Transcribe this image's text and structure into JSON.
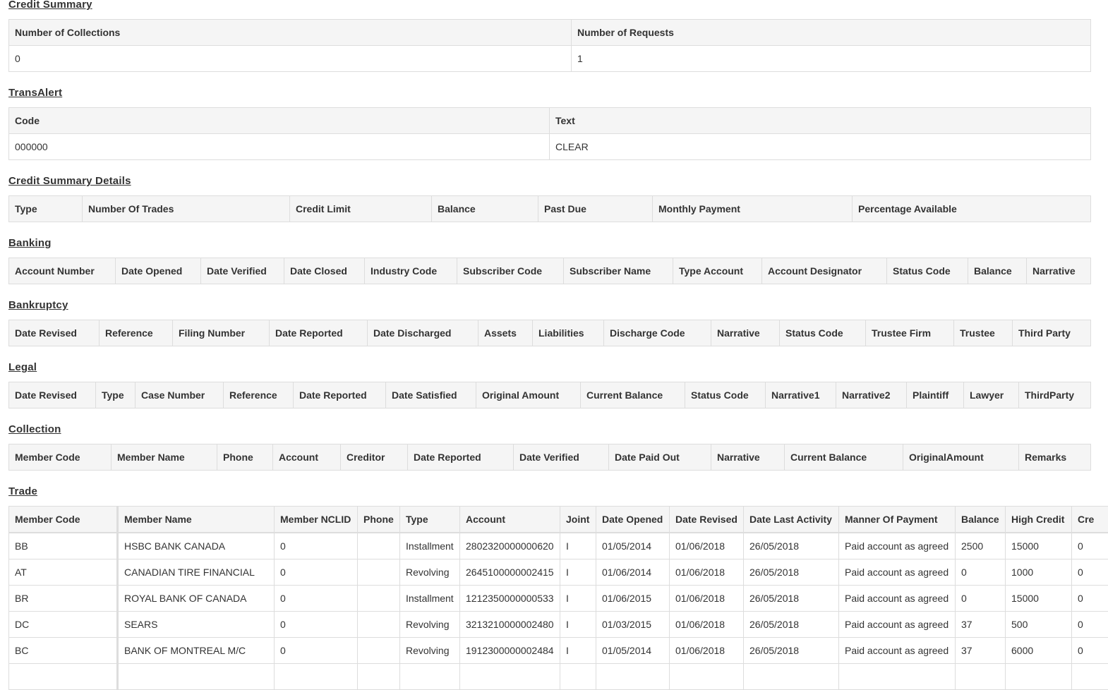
{
  "credit_summary": {
    "title": "Credit Summary",
    "headers": [
      "Number of Collections",
      "Number of Requests"
    ],
    "values": [
      "0",
      "1"
    ]
  },
  "transalert": {
    "title": "TransAlert",
    "headers": [
      "Code",
      "Text"
    ],
    "values": [
      "000000",
      "CLEAR"
    ]
  },
  "credit_summary_details": {
    "title": "Credit Summary Details",
    "headers": [
      "Type",
      "Number Of Trades",
      "Credit Limit",
      "Balance",
      "Past Due",
      "Monthly Payment",
      "Percentage Available"
    ]
  },
  "banking": {
    "title": "Banking",
    "headers": [
      "Account Number",
      "Date Opened",
      "Date Verified",
      "Date Closed",
      "Industry Code",
      "Subscriber Code",
      "Subscriber Name",
      "Type Account",
      "Account Designator",
      "Status Code",
      "Balance",
      "Narrative"
    ]
  },
  "bankruptcy": {
    "title": "Bankruptcy",
    "headers": [
      "Date Revised",
      "Reference",
      "Filing Number",
      "Date Reported",
      "Date Discharged",
      "Assets",
      "Liabilities",
      "Discharge Code",
      "Narrative",
      "Status Code",
      "Trustee Firm",
      "Trustee",
      "Third Party"
    ]
  },
  "legal": {
    "title": "Legal",
    "headers": [
      "Date Revised",
      "Type",
      "Case Number",
      "Reference",
      "Date Reported",
      "Date Satisfied",
      "Original Amount",
      "Current Balance",
      "Status Code",
      "Narrative1",
      "Narrative2",
      "Plaintiff",
      "Lawyer",
      "ThirdParty"
    ]
  },
  "collection": {
    "title": "Collection",
    "headers": [
      "Member Code",
      "Member Name",
      "Phone",
      "Account",
      "Creditor",
      "Date Reported",
      "Date Verified",
      "Date Paid Out",
      "Narrative",
      "Current Balance",
      "OriginalAmount",
      "Remarks"
    ]
  },
  "trade": {
    "title": "Trade",
    "headers": [
      "Member Code",
      "Member Name",
      "Member NCLID",
      "Phone",
      "Type",
      "Account",
      "Joint",
      "Date Opened",
      "Date Revised",
      "Date Last Activity",
      "Manner Of Payment",
      "Balance",
      "High Credit",
      "Cre"
    ],
    "rows": [
      [
        "BB",
        "HSBC BANK CANADA",
        "0",
        "",
        "Installment",
        "2802320000000620",
        "I",
        "01/05/2014",
        "01/06/2018",
        "26/05/2018",
        "Paid account as agreed",
        "2500",
        "15000",
        "0"
      ],
      [
        "AT",
        "CANADIAN TIRE FINANCIAL",
        "0",
        "",
        "Revolving",
        "2645100000002415",
        "I",
        "01/06/2014",
        "01/06/2018",
        "26/05/2018",
        "Paid account as agreed",
        "0",
        "1000",
        "0"
      ],
      [
        "BR",
        "ROYAL BANK OF CANADA",
        "0",
        "",
        "Installment",
        "1212350000000533",
        "I",
        "01/06/2015",
        "01/06/2018",
        "26/05/2018",
        "Paid account as agreed",
        "0",
        "15000",
        "0"
      ],
      [
        "DC",
        "SEARS",
        "0",
        "",
        "Revolving",
        "3213210000002480",
        "I",
        "01/03/2015",
        "01/06/2018",
        "26/05/2018",
        "Paid account as agreed",
        "37",
        "500",
        "0"
      ],
      [
        "BC",
        "BANK OF MONTREAL M/C",
        "0",
        "",
        "Revolving",
        "1912300000002484",
        "I",
        "01/05/2014",
        "01/06/2018",
        "26/05/2018",
        "Paid account as agreed",
        "37",
        "6000",
        "0"
      ],
      [
        "",
        "",
        "",
        "",
        "",
        "",
        "",
        "",
        "",
        "",
        "",
        "",
        "",
        ""
      ]
    ]
  }
}
